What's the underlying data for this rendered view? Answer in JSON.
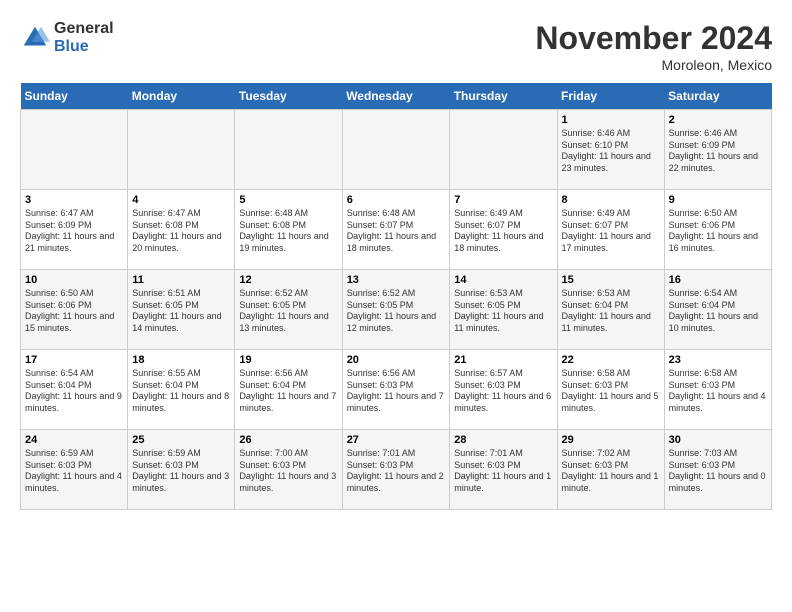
{
  "header": {
    "logo_general": "General",
    "logo_blue": "Blue",
    "month_title": "November 2024",
    "location": "Moroleon, Mexico"
  },
  "days_of_week": [
    "Sunday",
    "Monday",
    "Tuesday",
    "Wednesday",
    "Thursday",
    "Friday",
    "Saturday"
  ],
  "weeks": [
    [
      {
        "num": "",
        "info": ""
      },
      {
        "num": "",
        "info": ""
      },
      {
        "num": "",
        "info": ""
      },
      {
        "num": "",
        "info": ""
      },
      {
        "num": "",
        "info": ""
      },
      {
        "num": "1",
        "info": "Sunrise: 6:46 AM\nSunset: 6:10 PM\nDaylight: 11 hours and 23 minutes."
      },
      {
        "num": "2",
        "info": "Sunrise: 6:46 AM\nSunset: 6:09 PM\nDaylight: 11 hours and 22 minutes."
      }
    ],
    [
      {
        "num": "3",
        "info": "Sunrise: 6:47 AM\nSunset: 6:09 PM\nDaylight: 11 hours and 21 minutes."
      },
      {
        "num": "4",
        "info": "Sunrise: 6:47 AM\nSunset: 6:08 PM\nDaylight: 11 hours and 20 minutes."
      },
      {
        "num": "5",
        "info": "Sunrise: 6:48 AM\nSunset: 6:08 PM\nDaylight: 11 hours and 19 minutes."
      },
      {
        "num": "6",
        "info": "Sunrise: 6:48 AM\nSunset: 6:07 PM\nDaylight: 11 hours and 18 minutes."
      },
      {
        "num": "7",
        "info": "Sunrise: 6:49 AM\nSunset: 6:07 PM\nDaylight: 11 hours and 18 minutes."
      },
      {
        "num": "8",
        "info": "Sunrise: 6:49 AM\nSunset: 6:07 PM\nDaylight: 11 hours and 17 minutes."
      },
      {
        "num": "9",
        "info": "Sunrise: 6:50 AM\nSunset: 6:06 PM\nDaylight: 11 hours and 16 minutes."
      }
    ],
    [
      {
        "num": "10",
        "info": "Sunrise: 6:50 AM\nSunset: 6:06 PM\nDaylight: 11 hours and 15 minutes."
      },
      {
        "num": "11",
        "info": "Sunrise: 6:51 AM\nSunset: 6:05 PM\nDaylight: 11 hours and 14 minutes."
      },
      {
        "num": "12",
        "info": "Sunrise: 6:52 AM\nSunset: 6:05 PM\nDaylight: 11 hours and 13 minutes."
      },
      {
        "num": "13",
        "info": "Sunrise: 6:52 AM\nSunset: 6:05 PM\nDaylight: 11 hours and 12 minutes."
      },
      {
        "num": "14",
        "info": "Sunrise: 6:53 AM\nSunset: 6:05 PM\nDaylight: 11 hours and 11 minutes."
      },
      {
        "num": "15",
        "info": "Sunrise: 6:53 AM\nSunset: 6:04 PM\nDaylight: 11 hours and 11 minutes."
      },
      {
        "num": "16",
        "info": "Sunrise: 6:54 AM\nSunset: 6:04 PM\nDaylight: 11 hours and 10 minutes."
      }
    ],
    [
      {
        "num": "17",
        "info": "Sunrise: 6:54 AM\nSunset: 6:04 PM\nDaylight: 11 hours and 9 minutes."
      },
      {
        "num": "18",
        "info": "Sunrise: 6:55 AM\nSunset: 6:04 PM\nDaylight: 11 hours and 8 minutes."
      },
      {
        "num": "19",
        "info": "Sunrise: 6:56 AM\nSunset: 6:04 PM\nDaylight: 11 hours and 7 minutes."
      },
      {
        "num": "20",
        "info": "Sunrise: 6:56 AM\nSunset: 6:03 PM\nDaylight: 11 hours and 7 minutes."
      },
      {
        "num": "21",
        "info": "Sunrise: 6:57 AM\nSunset: 6:03 PM\nDaylight: 11 hours and 6 minutes."
      },
      {
        "num": "22",
        "info": "Sunrise: 6:58 AM\nSunset: 6:03 PM\nDaylight: 11 hours and 5 minutes."
      },
      {
        "num": "23",
        "info": "Sunrise: 6:58 AM\nSunset: 6:03 PM\nDaylight: 11 hours and 4 minutes."
      }
    ],
    [
      {
        "num": "24",
        "info": "Sunrise: 6:59 AM\nSunset: 6:03 PM\nDaylight: 11 hours and 4 minutes."
      },
      {
        "num": "25",
        "info": "Sunrise: 6:59 AM\nSunset: 6:03 PM\nDaylight: 11 hours and 3 minutes."
      },
      {
        "num": "26",
        "info": "Sunrise: 7:00 AM\nSunset: 6:03 PM\nDaylight: 11 hours and 3 minutes."
      },
      {
        "num": "27",
        "info": "Sunrise: 7:01 AM\nSunset: 6:03 PM\nDaylight: 11 hours and 2 minutes."
      },
      {
        "num": "28",
        "info": "Sunrise: 7:01 AM\nSunset: 6:03 PM\nDaylight: 11 hours and 1 minute."
      },
      {
        "num": "29",
        "info": "Sunrise: 7:02 AM\nSunset: 6:03 PM\nDaylight: 11 hours and 1 minute."
      },
      {
        "num": "30",
        "info": "Sunrise: 7:03 AM\nSunset: 6:03 PM\nDaylight: 11 hours and 0 minutes."
      }
    ]
  ]
}
